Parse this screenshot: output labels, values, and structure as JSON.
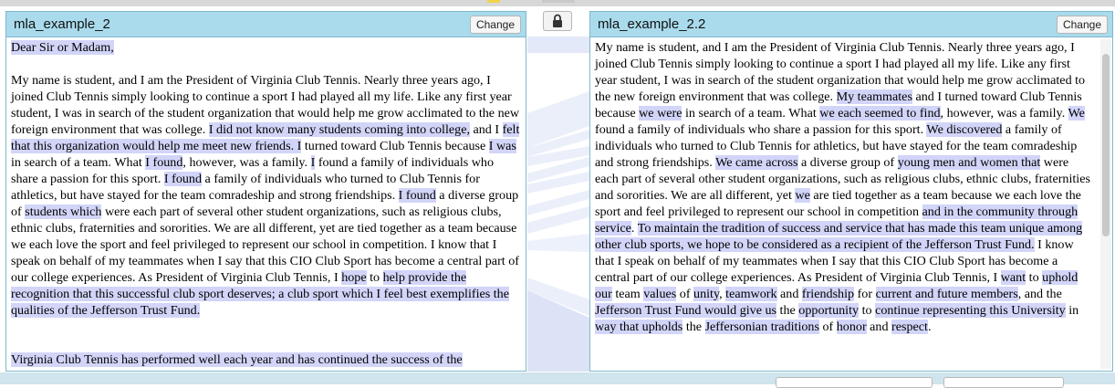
{
  "left_panel": {
    "title": "mla_example_2",
    "change_label": "Change",
    "salutation": "Dear Sir or Madam,",
    "p1": [
      {
        "t": "My name is student, and I am the President of Virginia Club Tennis. Nearly three years ago, I joined Club Tennis simply looking to continue a sport I had played all my life. Like any first year student, I was in search of the student organization that would help me grow acclimated to the new foreign environment that was college. ",
        "h": false
      },
      {
        "t": "I did not know many students coming into college,",
        "h": true
      },
      {
        "t": " and I ",
        "h": false
      },
      {
        "t": "felt that this organization would help me meet new friends. I",
        "h": true
      },
      {
        "t": " turned toward Club Tennis because ",
        "h": false
      },
      {
        "t": "I was",
        "h": true
      },
      {
        "t": " in search of a team. What ",
        "h": false
      },
      {
        "t": "I found",
        "h": true
      },
      {
        "t": ", however, was a family. ",
        "h": false
      },
      {
        "t": "I",
        "h": true
      },
      {
        "t": " found a family of individuals who share a passion for this sport. ",
        "h": false
      },
      {
        "t": "I found",
        "h": true
      },
      {
        "t": " a family of individuals who turned to Club Tennis for athletics, but have stayed for the team comradeship and strong friendships. ",
        "h": false
      },
      {
        "t": "I found",
        "h": true
      },
      {
        "t": " a diverse group of ",
        "h": false
      },
      {
        "t": "students which",
        "h": true
      },
      {
        "t": " were each part of several other student organizations, such as religious clubs, ethnic clubs, fraternities and sororities. We are all different, yet are tied together as a team because we each love the sport and feel privileged to represent our school in competition. I know that I speak on behalf of my teammates when I say that this CIO Club Sport has become a central part of our college experiences. As President of Virginia Club Tennis, I ",
        "h": false
      },
      {
        "t": "hope",
        "h": true
      },
      {
        "t": " to ",
        "h": false
      },
      {
        "t": "help provide the recognition that this successful club sport deserves; a club sport which I feel best exemplifies the qualities of the Jefferson Trust Fund.",
        "h": true
      }
    ],
    "p2": "Virginia Club Tennis has performed well each year and has continued the success of the"
  },
  "right_panel": {
    "title": "mla_example_2.2",
    "change_label": "Change",
    "p1": [
      {
        "t": "My name is student, and I am the President of Virginia Club Tennis. Nearly three years ago, I joined Club Tennis simply looking to continue a sport I had played all my life. Like any first year student, I was in search of the student organization that would help me grow acclimated to the new foreign environment that was college. ",
        "h": false
      },
      {
        "t": "My teammates",
        "h": true
      },
      {
        "t": " and I turned toward Club Tennis because ",
        "h": false
      },
      {
        "t": "we were",
        "h": true
      },
      {
        "t": " in search of a team. What ",
        "h": false
      },
      {
        "t": "we each seemed to find",
        "h": true
      },
      {
        "t": ", however, was a family. ",
        "h": false
      },
      {
        "t": "We",
        "h": true
      },
      {
        "t": " found a family of individuals who share a passion for this sport. ",
        "h": false
      },
      {
        "t": "We discovered",
        "h": true
      },
      {
        "t": " a family of individuals who turned to Club Tennis for athletics, but have stayed for the team comradeship and strong friendships. ",
        "h": false
      },
      {
        "t": "We came across",
        "h": true
      },
      {
        "t": " a diverse group of ",
        "h": false
      },
      {
        "t": "young men and women that",
        "h": true
      },
      {
        "t": " were each part of several other student organizations, such as religious clubs, ethnic clubs, fraternities and sororities. We are all different, yet ",
        "h": false
      },
      {
        "t": "we",
        "h": true
      },
      {
        "t": " are tied together as a team because we each love the sport and feel privileged to represent our school in competition ",
        "h": false
      },
      {
        "t": "and in the community through service",
        "h": true
      },
      {
        "t": ". ",
        "h": false
      },
      {
        "t": "To maintain the tradition of success and service that has made this team unique among other club sports, we hope to be considered as a recipient of the Jefferson Trust Fund.",
        "h": true
      },
      {
        "t": " I know that I speak on behalf of my teammates when I say that this CIO Club Sport has become a central part of our college experiences. As President of Virginia Club Tennis, I ",
        "h": false
      },
      {
        "t": "want",
        "h": true
      },
      {
        "t": " to ",
        "h": false
      },
      {
        "t": "uphold our",
        "h": true
      },
      {
        "t": " team ",
        "h": false
      },
      {
        "t": "values",
        "h": true
      },
      {
        "t": " of ",
        "h": false
      },
      {
        "t": "unity",
        "h": true
      },
      {
        "t": ", ",
        "h": false
      },
      {
        "t": "teamwork",
        "h": true
      },
      {
        "t": " and ",
        "h": false
      },
      {
        "t": "friendship",
        "h": true
      },
      {
        "t": " for ",
        "h": false
      },
      {
        "t": "current and future members",
        "h": true
      },
      {
        "t": ", and the ",
        "h": false
      },
      {
        "t": "Jefferson Trust Fund would give us",
        "h": true
      },
      {
        "t": " the ",
        "h": false
      },
      {
        "t": "opportunity",
        "h": true
      },
      {
        "t": " to ",
        "h": false
      },
      {
        "t": "continue representing this University",
        "h": true
      },
      {
        "t": " in ",
        "h": false
      },
      {
        "t": "way that upholds",
        "h": true
      },
      {
        "t": " the ",
        "h": false
      },
      {
        "t": "Jeffersonian traditions",
        "h": true
      },
      {
        "t": " of ",
        "h": false
      },
      {
        "t": "honor",
        "h": true
      },
      {
        "t": " and ",
        "h": false
      },
      {
        "t": "respect",
        "h": true
      },
      {
        "t": ".",
        "h": false
      }
    ]
  },
  "colors": {
    "header_bg": "#a9dbec",
    "highlight": "#d2d5f8",
    "connector": "#c9d4f2"
  },
  "icons": {
    "lock": "lock-icon"
  }
}
